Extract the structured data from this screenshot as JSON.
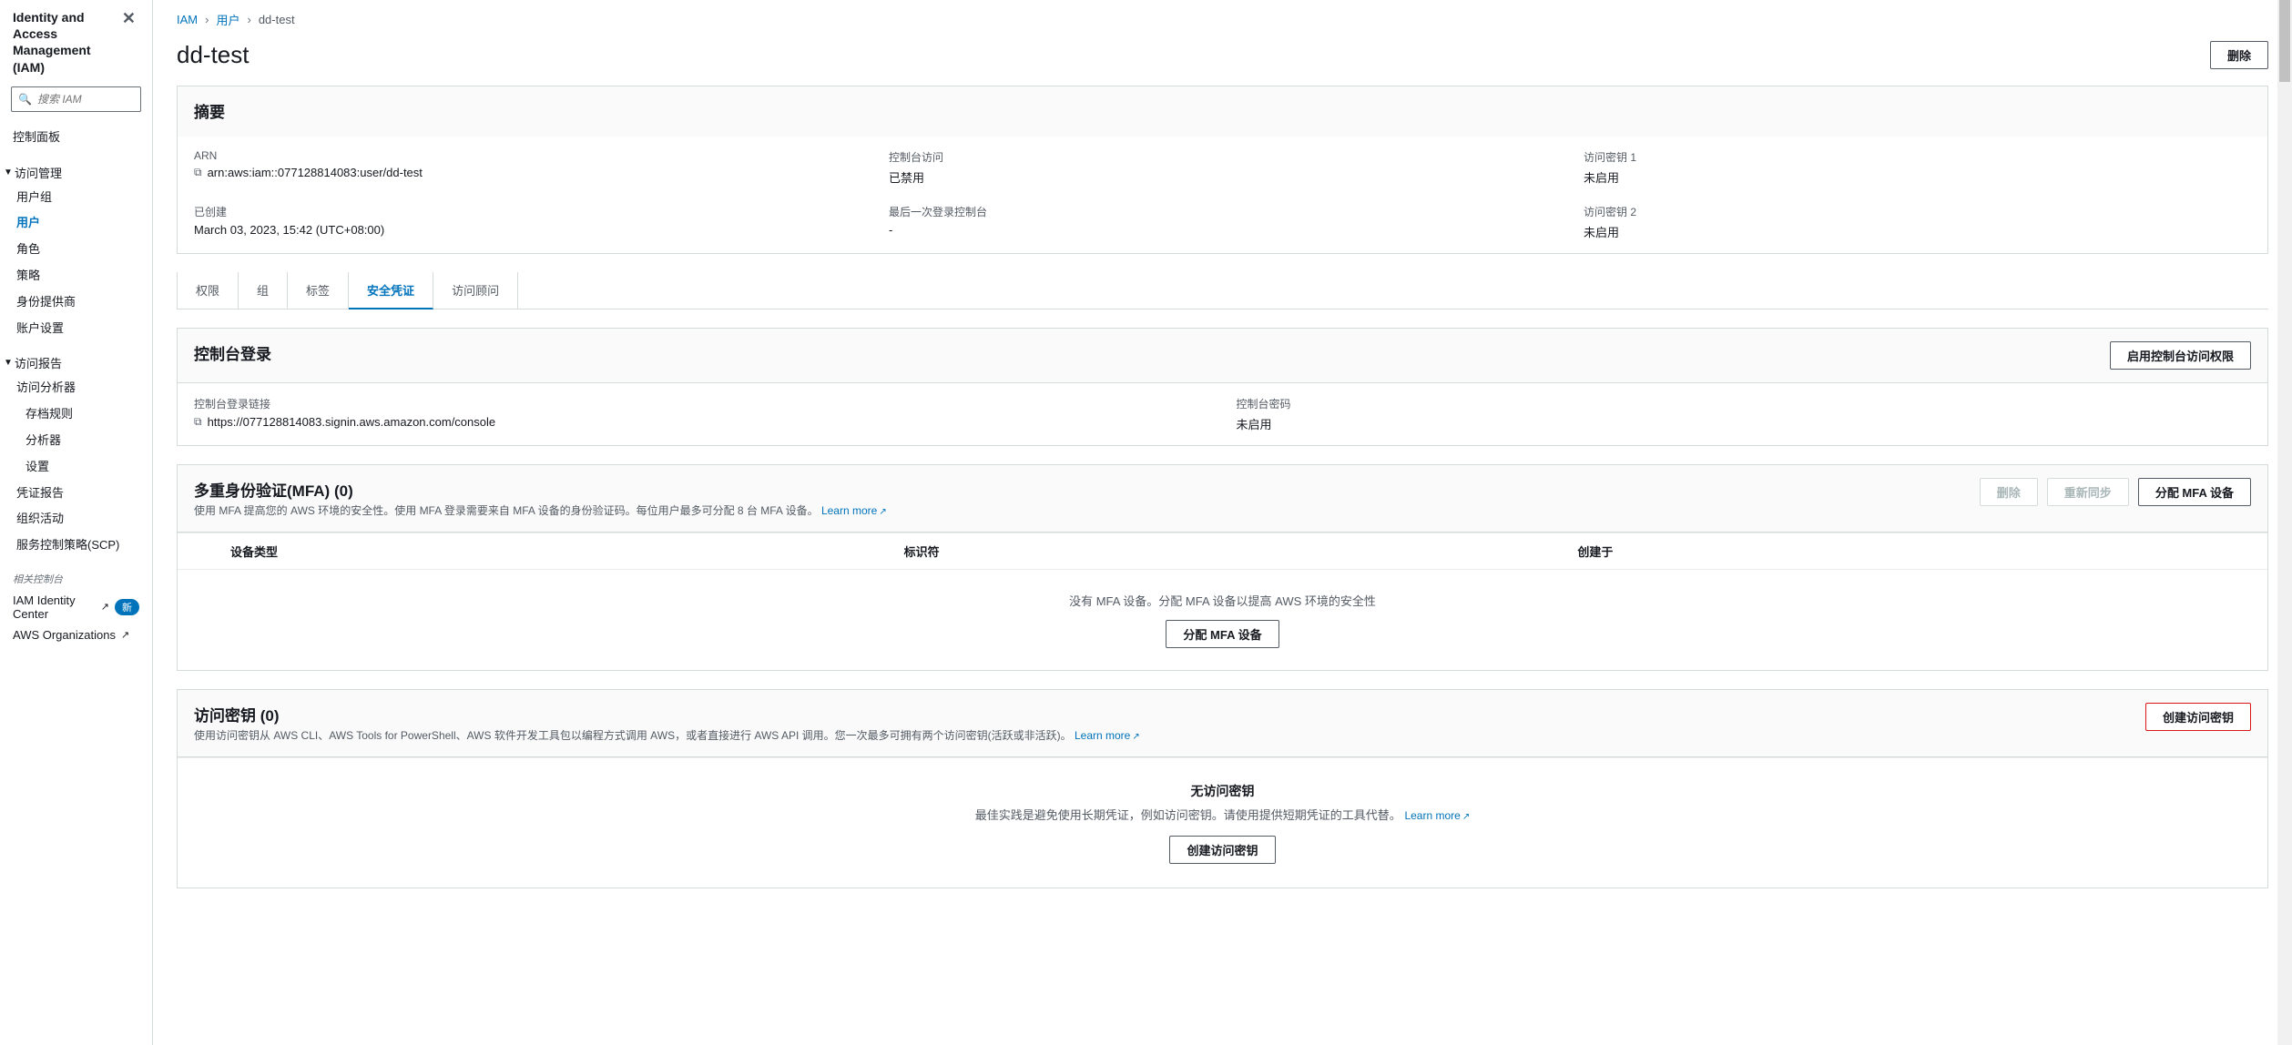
{
  "sidebar": {
    "title": "Identity and Access Management (IAM)",
    "search_placeholder": "搜索 IAM",
    "dashboard": "控制面板",
    "group_access": "访问管理",
    "items_access": [
      "用户组",
      "用户",
      "角色",
      "策略",
      "身份提供商",
      "账户设置"
    ],
    "group_reports": "访问报告",
    "items_reports": [
      "访问分析器",
      "存档规则",
      "分析器",
      "设置",
      "凭证报告",
      "组织活动",
      "服务控制策略(SCP)"
    ],
    "related_label": "相关控制台",
    "related": [
      {
        "label": "IAM Identity Center",
        "badge": "新"
      },
      {
        "label": "AWS Organizations"
      }
    ]
  },
  "breadcrumb": [
    "IAM",
    "用户",
    "dd-test"
  ],
  "page": {
    "title": "dd-test",
    "delete_btn": "删除"
  },
  "summary": {
    "title": "摘要",
    "fields": {
      "arn_label": "ARN",
      "arn_value": "arn:aws:iam::077128814083:user/dd-test",
      "console_access_label": "控制台访问",
      "console_access_value": "已禁用",
      "ak1_label": "访问密钥 1",
      "ak1_value": "未启用",
      "created_label": "已创建",
      "created_value": "March 03, 2023, 15:42 (UTC+08:00)",
      "last_login_label": "最后一次登录控制台",
      "last_login_value": "-",
      "ak2_label": "访问密钥 2",
      "ak2_value": "未启用"
    }
  },
  "tabs": [
    "权限",
    "组",
    "标签",
    "安全凭证",
    "访问顾问"
  ],
  "console_login": {
    "title": "控制台登录",
    "enable_btn": "启用控制台访问权限",
    "link_label": "控制台登录链接",
    "link_value": "https://077128814083.signin.aws.amazon.com/console",
    "pwd_label": "控制台密码",
    "pwd_value": "未启用"
  },
  "mfa": {
    "title": "多重身份验证(MFA)",
    "count": "(0)",
    "subtitle_prefix": "使用 MFA 提高您的 AWS 环境的安全性。使用 MFA 登录需要来自 MFA 设备的身份验证码。每位用户最多可分配 8 台 MFA 设备。",
    "learn_more": "Learn more",
    "btn_delete": "删除",
    "btn_resync": "重新同步",
    "btn_assign": "分配 MFA 设备",
    "cols": [
      "设备类型",
      "标识符",
      "创建于"
    ],
    "empty_text": "没有 MFA 设备。分配 MFA 设备以提高 AWS 环境的安全性",
    "empty_btn": "分配 MFA 设备"
  },
  "access_keys": {
    "title": "访问密钥",
    "count": "(0)",
    "subtitle_prefix": "使用访问密钥从 AWS CLI、AWS Tools for PowerShell、AWS 软件开发工具包以编程方式调用 AWS，或者直接进行 AWS API 调用。您一次最多可拥有两个访问密钥(活跃或非活跃)。",
    "learn_more": "Learn more",
    "btn_create": "创建访问密钥",
    "empty_title": "无访问密钥",
    "empty_text_prefix": "最佳实践是避免使用长期凭证，例如访问密钥。请使用提供短期凭证的工具代替。",
    "empty_learn_more": "Learn more",
    "empty_btn": "创建访问密钥"
  }
}
